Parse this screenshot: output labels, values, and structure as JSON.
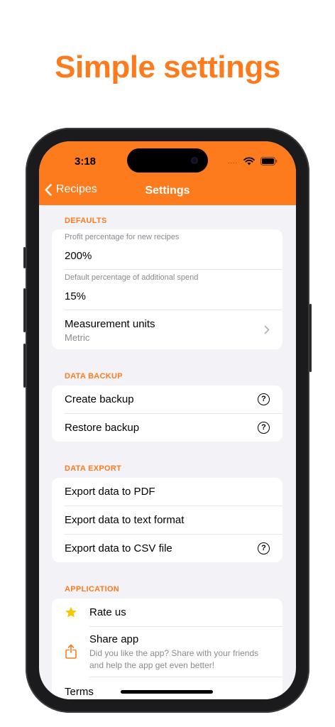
{
  "headline": "Simple settings",
  "status_bar": {
    "time": "3:18",
    "signal_dots": "....",
    "wifi_icon": "wifi-icon",
    "battery_icon": "battery-icon"
  },
  "nav": {
    "back_label": "Recipes",
    "title": "Settings"
  },
  "sections": {
    "defaults": {
      "header": "DEFAULTS",
      "profit_caption": "Profit percentage for new recipes",
      "profit_value": "200%",
      "spend_caption": "Default percentage of additional spend",
      "spend_value": "15%",
      "units_label": "Measurement units",
      "units_value": "Metric"
    },
    "backup": {
      "header": "DATA BACKUP",
      "create_label": "Create backup",
      "restore_label": "Restore backup"
    },
    "export": {
      "header": "DATA EXPORT",
      "pdf_label": "Export data to PDF",
      "text_label": "Export data to text format",
      "csv_label": "Export data to CSV file"
    },
    "application": {
      "header": "APPLICATION",
      "rate_label": "Rate us",
      "share_label": "Share app",
      "share_desc_line1": "Did you like the app? Share with your friends",
      "share_desc_line2": "and help the app get even better!",
      "terms_label": "Terms"
    }
  },
  "colors": {
    "accent": "#FD7B1C",
    "background": "#F2F2F7",
    "star": "#F7C600"
  }
}
